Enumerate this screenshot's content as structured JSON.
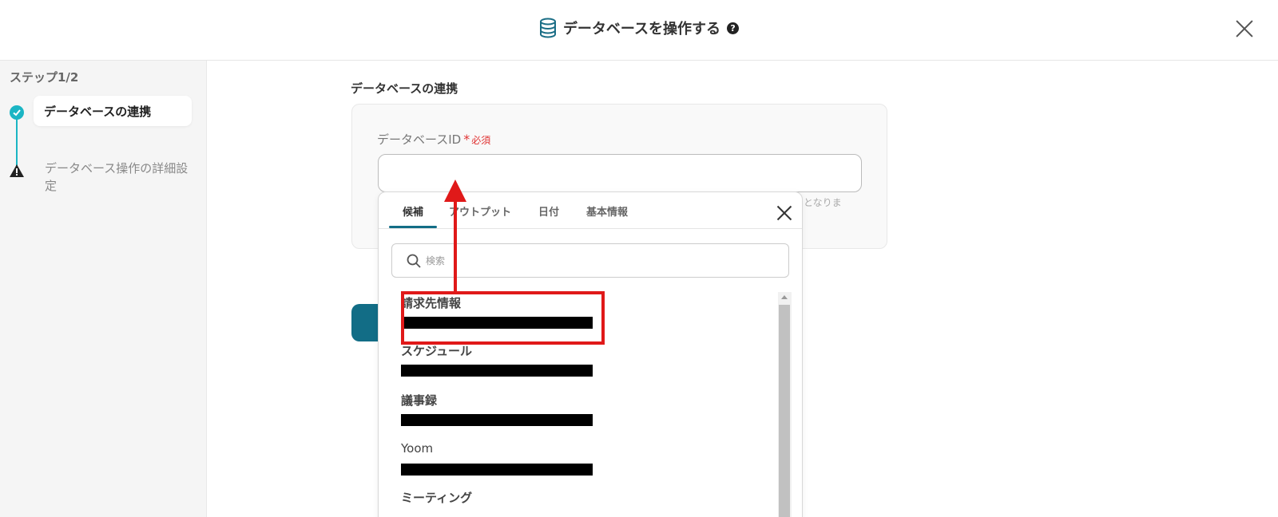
{
  "header": {
    "title": "データベースを操作する",
    "help_label": "?",
    "db_icon": "database-icon",
    "close_icon": "close-icon"
  },
  "sidebar": {
    "step_count": "ステップ1/2",
    "steps": [
      {
        "label": "データベースの連携",
        "status": "complete",
        "icon": "check-circle-icon"
      },
      {
        "label": "データベース操作の詳細設定",
        "status": "warning",
        "icon": "warning-icon"
      }
    ]
  },
  "main": {
    "section_title": "データベースの連携",
    "field": {
      "label": "データベースID",
      "required_mark": "*",
      "required_text": "必須",
      "value": "",
      "hint_fragment": "となりま"
    }
  },
  "dropdown": {
    "tabs": [
      {
        "label": "候補",
        "active": true
      },
      {
        "label": "アウトプット",
        "active": false
      },
      {
        "label": "日付",
        "active": false
      },
      {
        "label": "基本情報",
        "active": false
      }
    ],
    "search_placeholder": "検索",
    "options": [
      {
        "name": "請求先情報",
        "id_redacted": true,
        "highlighted": true
      },
      {
        "name": "スケジュール",
        "id_redacted": true,
        "highlighted": false
      },
      {
        "name": "議事録",
        "id_redacted": true,
        "highlighted": false
      },
      {
        "name": "Yoom",
        "id_redacted": true,
        "highlighted": false
      },
      {
        "name": "ミーティング",
        "id_redacted": false,
        "highlighted": false
      }
    ]
  },
  "colors": {
    "accent": "#126d86",
    "step_complete": "#1bb5c4",
    "required": "#e03333",
    "annotation": "#e01919"
  }
}
